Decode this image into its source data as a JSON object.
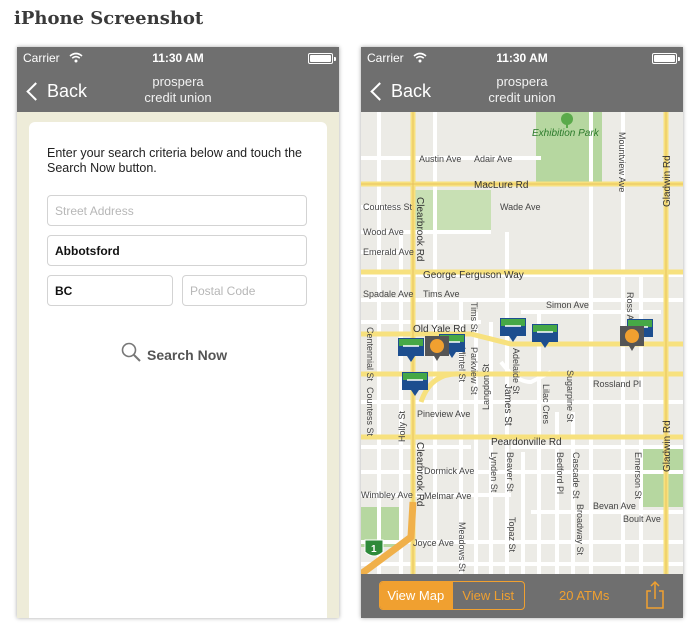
{
  "heading": "iPhone Screenshot",
  "status": {
    "carrier": "Carrier",
    "time": "11:30 AM"
  },
  "nav": {
    "back_label": "Back",
    "brand_line1": "prospera",
    "brand_line2": "credit union"
  },
  "search_form": {
    "instructions": "Enter your search criteria below and touch the Search Now button.",
    "street": {
      "placeholder": "Street Address",
      "value": ""
    },
    "city": {
      "value": "Abbotsford"
    },
    "province": {
      "value": "BC"
    },
    "postal": {
      "placeholder": "Postal Code",
      "value": ""
    },
    "search_button_label": "Search Now"
  },
  "map": {
    "park_label": "Exhibition Park",
    "streets": [
      "Austin Ave",
      "Adair Ave",
      "MacLure Rd",
      "Wade Ave",
      "Marion Ave",
      "Faber Ave",
      "Mouat Dr",
      "Clearbrook Rd",
      "George Ferguson Way",
      "Tims Ave",
      "Simon Ave",
      "Old Yale Rd",
      "Rossland Pl",
      "Pineview Ave",
      "Peardonville Rd",
      "Dormick Ave",
      "Melmar Ave",
      "Bevan Ave",
      "Boult Ave",
      "Joyce Ave",
      "Gladwin Rd",
      "Centennial St",
      "Countess St",
      "Holly St",
      "Langdon St",
      "Adelaide St",
      "James St",
      "Lilac Cres",
      "Sugarpine St",
      "Lynden St",
      "Beaver St",
      "Topaz St",
      "Broadway St",
      "Bedford Pl",
      "Cascade St",
      "Emerson St",
      "Meadows St",
      "Mintel St",
      "Parkview St",
      "Tims St",
      "Mountview Ave",
      "Ross Ave",
      "Spadale Ave",
      "Wood Ave",
      "Emerald Ave",
      "Wimbley Ave"
    ],
    "highway_shield": "1"
  },
  "bottom_bar": {
    "view_map": "View Map",
    "view_list": "View List",
    "atm_count": "20 ATMs"
  },
  "colors": {
    "nav_gray": "#6f6f6f",
    "accent_orange": "#f0a030",
    "atm_green": "#46a846",
    "atm_blue": "#1d4e8f",
    "park_green": "#b6d7a0",
    "form_bg": "#eeecd9",
    "major_road": "#f7e17e"
  },
  "icons": {
    "wifi": "wifi-icon",
    "battery": "battery-icon",
    "back": "chevron-left-icon",
    "search": "magnifier-icon",
    "share": "share-icon",
    "atm": "atm-pin-icon",
    "park": "park-tree-icon"
  }
}
